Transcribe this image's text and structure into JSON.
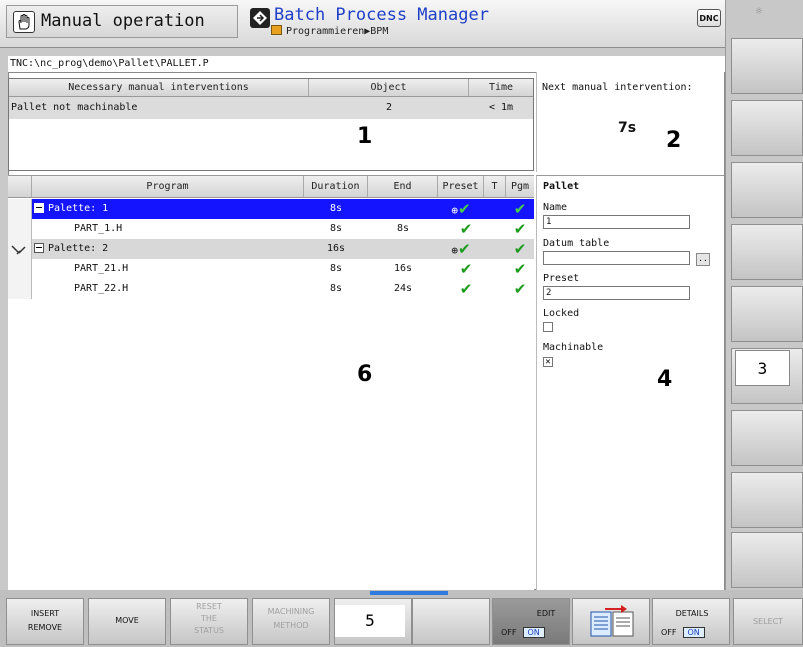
{
  "header": {
    "mode_title": "Manual operation",
    "app_title": "Batch Process Manager",
    "breadcrumb": "Programmieren▶BPM",
    "dnc_label": "DNC"
  },
  "path": "TNC:\\nc_prog\\demo\\Pallet\\PALLET.P",
  "interventions": {
    "headers": [
      "Necessary manual interventions",
      "Object",
      "Time"
    ],
    "rows": [
      {
        "text": "Pallet not machinable",
        "object": "2",
        "time": "< 1m"
      }
    ]
  },
  "next_intervention": {
    "label": "Next manual intervention:",
    "value": "7s"
  },
  "program_table": {
    "headers": [
      "Program",
      "Duration",
      "End",
      "Preset",
      "T",
      "Pgm"
    ],
    "rows": [
      {
        "program": "Palette: 1",
        "duration": "8s",
        "end": "",
        "preset": "✔",
        "pgm": "✔"
      },
      {
        "program": "PART_1.H",
        "duration": "8s",
        "end": "8s",
        "preset": "✔",
        "pgm": "✔"
      },
      {
        "program": "Palette: 2",
        "duration": "16s",
        "end": "",
        "preset": "✔",
        "pgm": "✔"
      },
      {
        "program": "PART_21.H",
        "duration": "8s",
        "end": "16s",
        "preset": "✔",
        "pgm": "✔"
      },
      {
        "program": "PART_22.H",
        "duration": "8s",
        "end": "24s",
        "preset": "✔",
        "pgm": "✔"
      }
    ]
  },
  "pallet": {
    "title": "Pallet",
    "name_label": "Name",
    "name_value": "1",
    "datum_label": "Datum table",
    "datum_value": "",
    "browse_label": "..",
    "preset_label": "Preset",
    "preset_value": "2",
    "locked_label": "Locked",
    "locked_mark": "",
    "machinable_label": "Machinable",
    "machinable_mark": "✕"
  },
  "annotations": {
    "n1": "1",
    "n2": "2",
    "n3": "3",
    "n4": "4",
    "n5": "5",
    "n6": "6"
  },
  "softkeys_bottom": {
    "insert_line1": "INSERT",
    "insert_line2": "REMOVE",
    "move": "MOVE",
    "reset_line1": "RESET",
    "reset_line2": "THE",
    "reset_line3": "STATUS",
    "machining_line1": "MACHINING",
    "machining_line2": "METHOD",
    "edit_label": "EDIT",
    "edit_off": "OFF",
    "edit_on": "ON",
    "details_label": "DETAILS",
    "details_off": "OFF",
    "details_on": "ON",
    "select": "SELECT"
  },
  "icons": {
    "mode": "hand-icon",
    "app": "bpm-icon",
    "breadcrumb": "home-icon",
    "sun": "sun-icon",
    "preset_target": "crosshair-icon"
  },
  "colors": {
    "selection": "#1414ff",
    "app_title": "#1e3fc8",
    "check": "#1c9b1c"
  }
}
